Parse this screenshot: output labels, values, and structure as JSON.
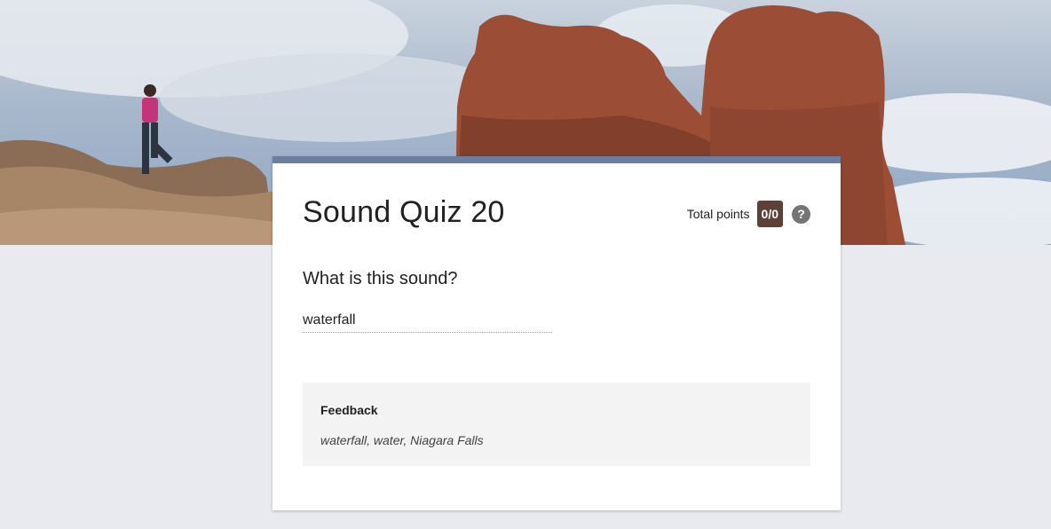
{
  "form": {
    "title": "Sound Quiz 20",
    "total_points_label": "Total points",
    "score": "0/0",
    "help_glyph": "?"
  },
  "question": {
    "text": "What is this sound?",
    "answer": "waterfall"
  },
  "feedback": {
    "title": "Feedback",
    "text": "waterfall, water, Niagara Falls"
  },
  "colors": {
    "accent_bar": "#6c7e9e",
    "score_badge": "#5d4037",
    "page_background": "#e8eaef"
  },
  "icons": {
    "help": "help-icon"
  }
}
